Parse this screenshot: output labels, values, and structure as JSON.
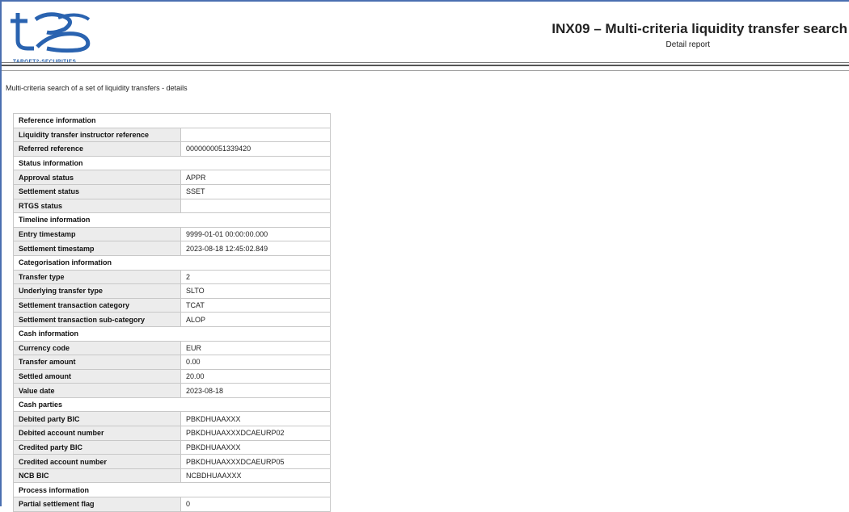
{
  "header": {
    "logo_text": "TARGET2-SECURITIES",
    "title": "INX09 – Multi-criteria liquidity transfer search",
    "subtitle": "Detail report"
  },
  "description": "Multi-criteria search of a set of liquidity transfers - details",
  "sections": [
    {
      "title": "Reference information",
      "rows": [
        {
          "label": "Liquidity transfer instructor reference",
          "value": ""
        },
        {
          "label": "Referred reference",
          "value": "0000000051339420"
        }
      ]
    },
    {
      "title": "Status information",
      "rows": [
        {
          "label": "Approval status",
          "value": "APPR"
        },
        {
          "label": "Settlement status",
          "value": "SSET"
        },
        {
          "label": "RTGS status",
          "value": ""
        }
      ]
    },
    {
      "title": "Timeline information",
      "rows": [
        {
          "label": "Entry timestamp",
          "value": "9999-01-01 00:00:00.000"
        },
        {
          "label": "Settlement timestamp",
          "value": "2023-08-18 12:45:02.849"
        }
      ]
    },
    {
      "title": "Categorisation information",
      "rows": [
        {
          "label": "Transfer type",
          "value": "2"
        },
        {
          "label": "Underlying transfer type",
          "value": "SLTO"
        },
        {
          "label": "Settlement transaction category",
          "value": "TCAT"
        },
        {
          "label": "Settlement transaction sub-category",
          "value": "ALOP"
        }
      ]
    },
    {
      "title": "Cash information",
      "rows": [
        {
          "label": "Currency code",
          "value": "EUR"
        },
        {
          "label": "Transfer amount",
          "value": "0.00"
        },
        {
          "label": "Settled amount",
          "value": "20.00"
        },
        {
          "label": "Value date",
          "value": "2023-08-18"
        }
      ]
    },
    {
      "title": "Cash parties",
      "rows": [
        {
          "label": "Debited party BIC",
          "value": "PBKDHUAAXXX"
        },
        {
          "label": "Debited account number",
          "value": "PBKDHUAAXXXDCAEURP02"
        },
        {
          "label": "Credited party BIC",
          "value": "PBKDHUAAXXX"
        },
        {
          "label": "Credited account number",
          "value": "PBKDHUAAXXXDCAEURP05"
        },
        {
          "label": "NCB BIC",
          "value": "NCBDHUAAXXX"
        }
      ]
    },
    {
      "title": "Process information",
      "rows": [
        {
          "label": "Partial settlement flag",
          "value": "0"
        }
      ]
    }
  ]
}
